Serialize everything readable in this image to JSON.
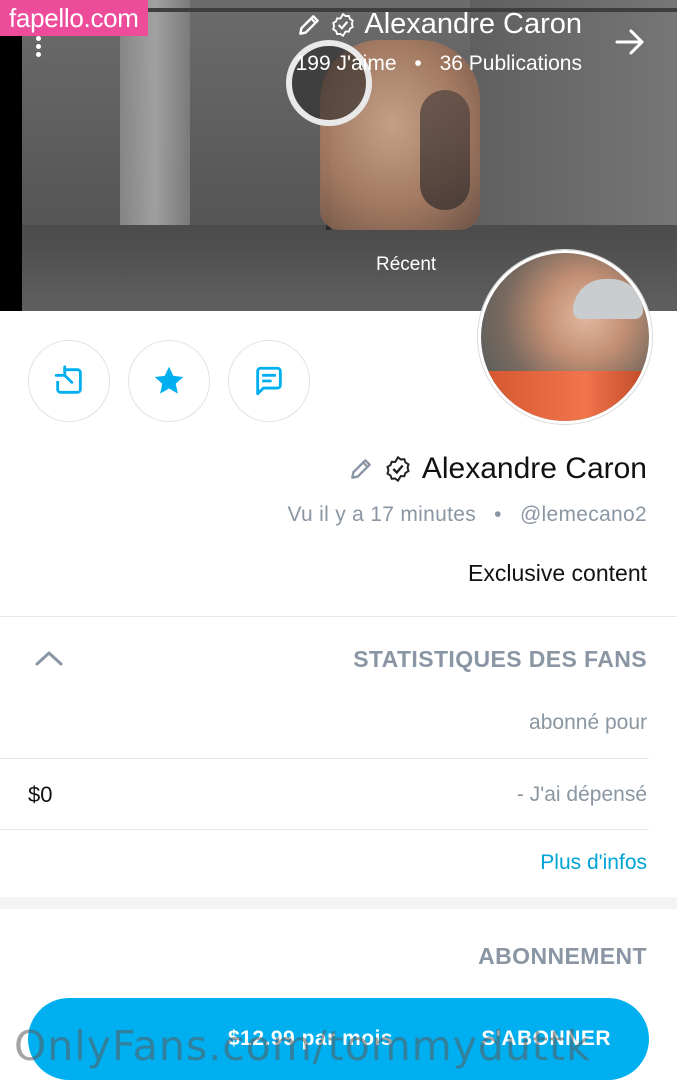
{
  "watermark_top": "fapello.com",
  "watermark_bottom": "OnlyFans.com/tommyduttk",
  "cover": {
    "title": "Alexandre Caron",
    "posts": "36 Publications",
    "likes": "199 J'aime",
    "separator": "•",
    "label": "Récent"
  },
  "profile": {
    "name": "Alexandre Caron",
    "handle": "@lemecano2",
    "last_seen": "Vu il y a 17 minutes",
    "separator": "•",
    "bio": "Exclusive content"
  },
  "fan_stats": {
    "title": "STATISTIQUES DES FANS",
    "subscribed_label": "abonné pour",
    "spent_label": "- J'ai dépensé",
    "spent_value": "$0",
    "more_link": "Plus d'infos"
  },
  "subscription": {
    "title": "ABONNEMENT",
    "button_label": "S'ABONNER",
    "price_label": "$12.99 par mois"
  },
  "colors": {
    "accent": "#00aff0",
    "link": "#00a3d6",
    "muted_text": "#8a96a3",
    "watermark_bg": "#ec4c9a"
  },
  "icons": [
    "dots-vertical-icon",
    "arrow-right-icon",
    "edit-pencil-icon",
    "verified-badge-icon",
    "share-icon",
    "star-icon",
    "message-icon",
    "chevron-up-icon"
  ]
}
